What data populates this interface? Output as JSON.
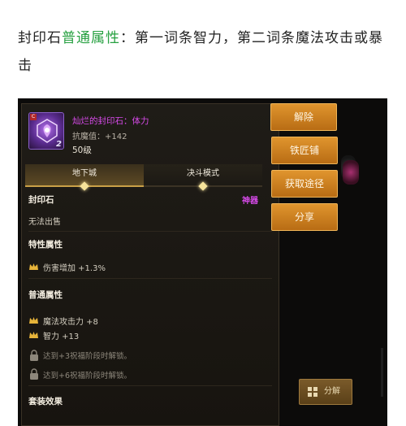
{
  "article": {
    "text_a": "封印石",
    "text_highlight": "普通属性",
    "text_b": "：第一词条智力，第二词条魔法攻击或暴击"
  },
  "item": {
    "icon_badge": "C",
    "icon_level": "2",
    "name": "灿烂的封印石：体力",
    "stat": "抗魔值：+142",
    "level": "50级"
  },
  "tabs": [
    {
      "label": "地下城",
      "active": true
    },
    {
      "label": "决斗模式",
      "active": false
    }
  ],
  "details": {
    "category": "封印石",
    "tag": "神器",
    "trade_status": "无法出售",
    "special_title": "特性属性",
    "special_attr": "伤害增加 +1.3%",
    "normal_title": "普通属性",
    "normal_attr_1": "魔法攻击力 +8",
    "normal_attr_2": "智力 +13",
    "unlock_1": "达到+3祝福阶段时解锁。",
    "unlock_2": "达到+6祝福阶段时解锁。",
    "set_title": "套装效果"
  },
  "buttons": {
    "unlock": "解除",
    "blacksmith": "铁匠铺",
    "obtain": "获取途径",
    "share": "分享",
    "decompose": "分解"
  },
  "colors": {
    "highlight_green": "#26a040",
    "item_purple": "#d64ae8",
    "button_orange": "#d0851f"
  }
}
